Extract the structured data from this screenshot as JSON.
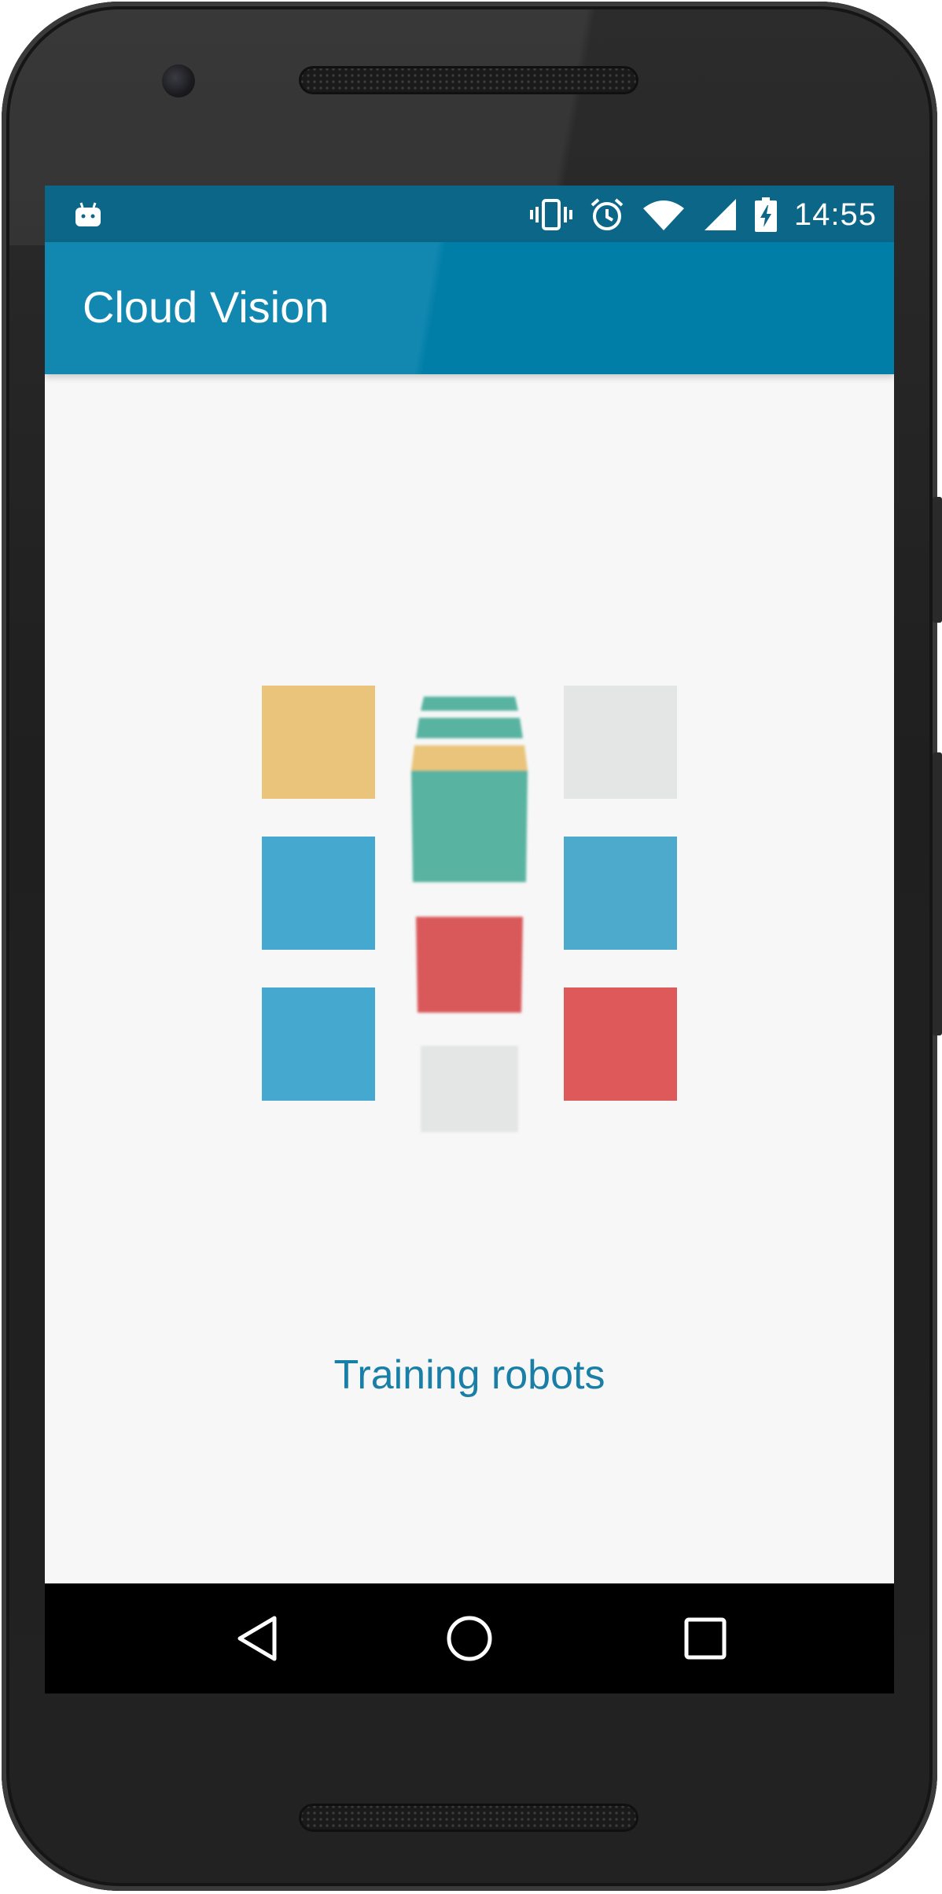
{
  "status_bar": {
    "time": "14:55",
    "icons": [
      "android-debug-icon",
      "vibrate-icon",
      "alarm-icon",
      "wifi-icon",
      "signal-icon",
      "battery-charging-icon"
    ]
  },
  "app_bar": {
    "title": "Cloud Vision"
  },
  "loading": {
    "message": "Training robots",
    "tile_colors": {
      "yellow": "#e9c47a",
      "blue": "#45a8cf",
      "green": "#59b3a0",
      "red": "#da5a5a",
      "grey": "#e3e6e5"
    }
  },
  "nav_bar": {
    "buttons": [
      "back-icon",
      "home-icon",
      "recents-icon"
    ]
  },
  "colors": {
    "primary": "#007ea7",
    "primary_dark": "#0b6688",
    "accent_text": "#1a7fa6"
  }
}
